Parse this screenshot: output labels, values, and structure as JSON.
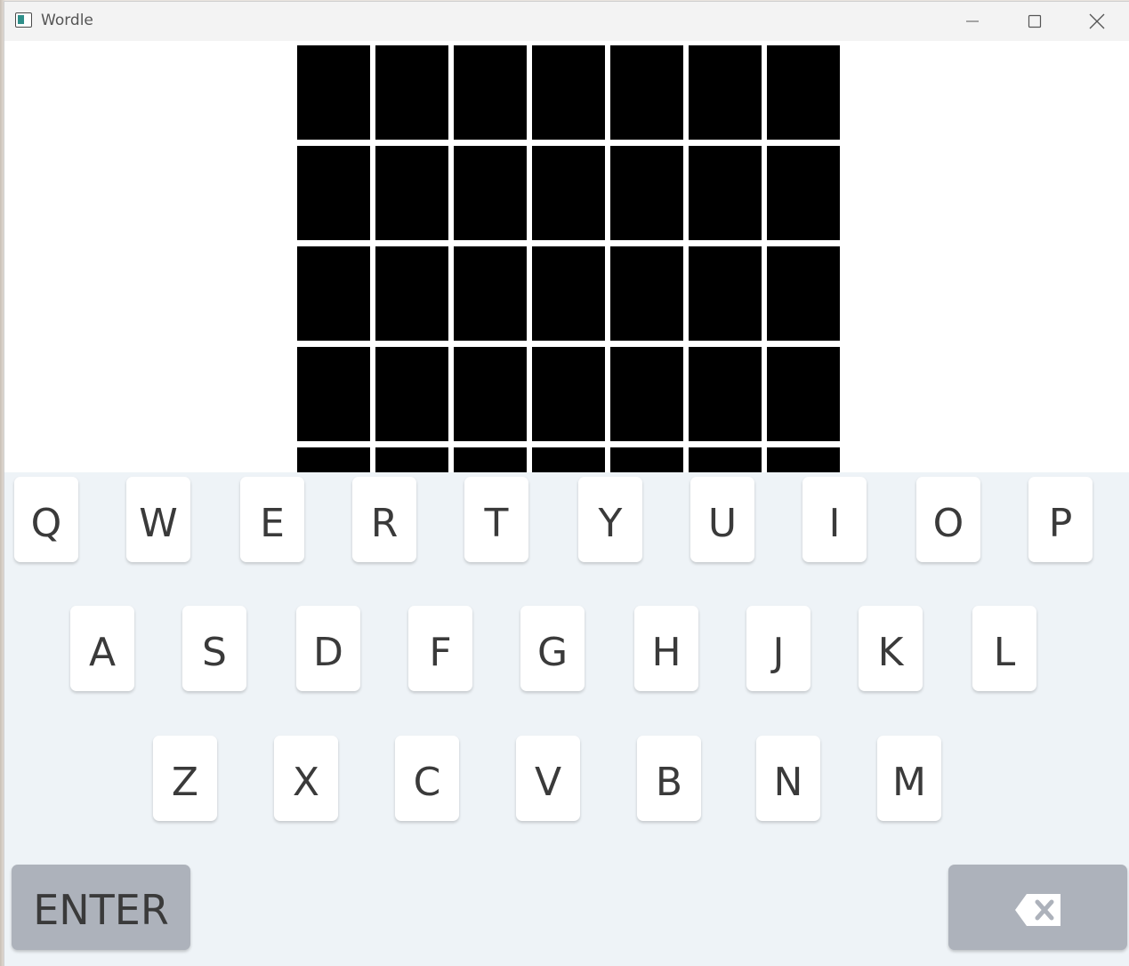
{
  "window": {
    "title": "Wordle"
  },
  "board": {
    "rows": 5,
    "columns": 7,
    "tile_color": "#000000"
  },
  "keyboard": {
    "row1": [
      "Q",
      "W",
      "E",
      "R",
      "T",
      "Y",
      "U",
      "I",
      "O",
      "P"
    ],
    "row2": [
      "A",
      "S",
      "D",
      "F",
      "G",
      "H",
      "J",
      "K",
      "L"
    ],
    "row3": [
      "Z",
      "X",
      "C",
      "V",
      "B",
      "N",
      "M"
    ],
    "enter_label": "ENTER",
    "backspace_icon": "backspace-icon",
    "key_color": "#ffffff",
    "action_key_color": "#adb2bb",
    "background_color": "#eef3f7"
  }
}
